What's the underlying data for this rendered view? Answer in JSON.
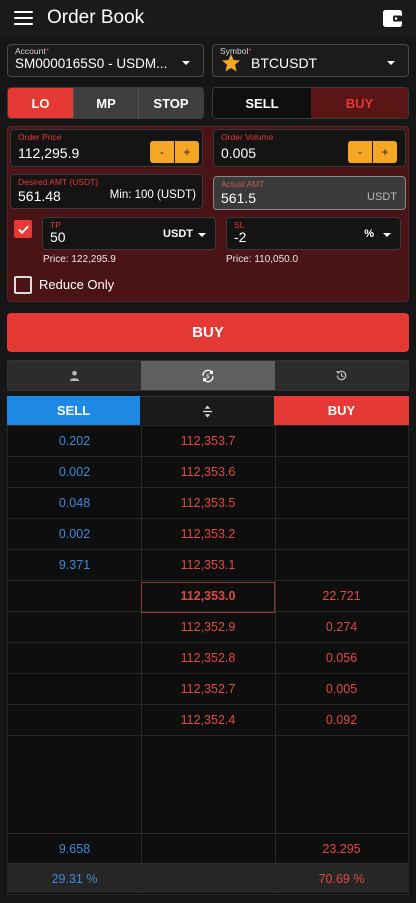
{
  "header": {
    "title": "Order Book"
  },
  "account": {
    "label": "Account",
    "required": "*",
    "value": "SM0000165S0 - USDM..."
  },
  "symbol": {
    "label": "Symbol",
    "required": "*",
    "value": "BTCUSDT"
  },
  "order_types": [
    "LO",
    "MP",
    "STOP"
  ],
  "sides": {
    "sell": "SELL",
    "buy": "BUY"
  },
  "order_price": {
    "label": "Order Price",
    "value": "112,295.9",
    "minus": "-",
    "plus": "+"
  },
  "order_volume": {
    "label": "Order Volume",
    "value": "0.005",
    "minus": "-",
    "plus": "+"
  },
  "desired_amt": {
    "label": "Desired AMT (USDT)",
    "value": "561.48",
    "min": "Min: 100 (USDT)"
  },
  "actual_amt": {
    "label": "Actual AMT",
    "value": "561.5",
    "unit": "USDT"
  },
  "tp": {
    "label": "TP",
    "value": "50",
    "unit": "USDT",
    "price": "Price: 122,295.9"
  },
  "sl": {
    "label": "SL",
    "value": "-2",
    "unit": "%",
    "price": "Price: 110,050.0"
  },
  "reduce_only": {
    "label": "Reduce Only"
  },
  "submit": {
    "label": "BUY"
  },
  "book_header": {
    "sell": "SELL",
    "buy": "BUY"
  },
  "book_rows": [
    {
      "sell": "0.202",
      "price": "112,353.7",
      "buy": ""
    },
    {
      "sell": "0.002",
      "price": "112,353.6",
      "buy": ""
    },
    {
      "sell": "0.048",
      "price": "112,353.5",
      "buy": ""
    },
    {
      "sell": "0.002",
      "price": "112,353.2",
      "buy": ""
    },
    {
      "sell": "9.371",
      "price": "112,353.1",
      "buy": ""
    },
    {
      "sell": "",
      "price": "112,353.0",
      "buy": "22.721"
    },
    {
      "sell": "",
      "price": "112,352.9",
      "buy": "0.274"
    },
    {
      "sell": "",
      "price": "112,352.8",
      "buy": "0.056"
    },
    {
      "sell": "",
      "price": "112,352.7",
      "buy": "0.005"
    },
    {
      "sell": "",
      "price": "112,352.4",
      "buy": "0.092"
    }
  ],
  "totals": {
    "sell": "9.658",
    "buy": "23.295"
  },
  "percent": {
    "sell": "29.31 %",
    "buy": "70.69 %"
  },
  "colors": {
    "sell": "#1e88e5",
    "buy": "#e53935",
    "accent": "#f5a623",
    "panel": "#4a1416"
  }
}
